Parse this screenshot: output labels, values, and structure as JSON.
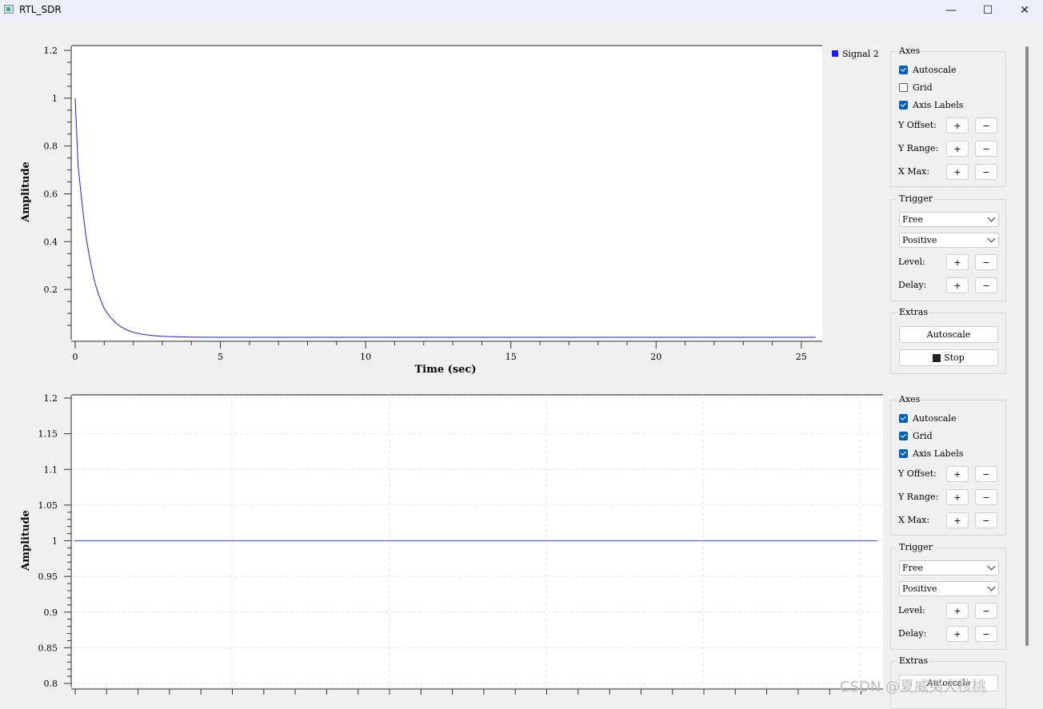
{
  "window": {
    "title": "RTL_SDR",
    "minimize": "—",
    "maximize": "☐",
    "close": "✕"
  },
  "plot1": {
    "ylabel": "Amplitude",
    "xlabel": "Time (sec)",
    "legend": "Signal 2",
    "grid": false,
    "series_color": "#1a1aff",
    "y_ticks": [
      "0.2",
      "0.4",
      "0.6",
      "0.8",
      "1",
      "1.2"
    ],
    "x_ticks": [
      "0",
      "5",
      "10",
      "15",
      "20",
      "25"
    ]
  },
  "plot2": {
    "ylabel": "Amplitude",
    "grid": true,
    "series_color": "#5566ee",
    "y_ticks": [
      "0.8",
      "0.85",
      "0.9",
      "0.95",
      "1",
      "1.05",
      "1.1",
      "1.15",
      "1.2"
    ]
  },
  "chart_data": [
    {
      "type": "line",
      "title": "",
      "xlabel": "Time (sec)",
      "ylabel": "Amplitude",
      "xlim": [
        -0.2,
        25.8
      ],
      "ylim": [
        0,
        1.22
      ],
      "grid": false,
      "legend": "top-right",
      "series": [
        {
          "name": "Signal 2",
          "x": [
            0,
            0.1,
            0.2,
            0.3,
            0.4,
            0.5,
            0.6,
            0.7,
            0.8,
            0.9,
            1,
            1.2,
            1.4,
            1.6,
            1.8,
            2,
            2.3,
            2.6,
            3,
            3.5,
            4,
            5,
            7,
            10,
            15,
            20,
            25.5
          ],
          "y": [
            1,
            0.72,
            0.6,
            0.49,
            0.4,
            0.33,
            0.27,
            0.22,
            0.18,
            0.15,
            0.12,
            0.085,
            0.06,
            0.042,
            0.03,
            0.021,
            0.013,
            0.008,
            0.004,
            0.002,
            0.001,
            0,
            0,
            0,
            0,
            0,
            0
          ]
        }
      ]
    },
    {
      "type": "line",
      "title": "",
      "xlabel": "",
      "ylabel": "Amplitude",
      "ylim": [
        0.8,
        1.2
      ],
      "grid": true,
      "series": [
        {
          "x": [
            0,
            1
          ],
          "y": [
            1,
            1
          ]
        }
      ]
    }
  ],
  "panel1": {
    "axes": {
      "title": "Axes",
      "autoscale": "Autoscale",
      "grid": "Grid",
      "axis_labels": "Axis Labels",
      "autoscale_checked": true,
      "grid_checked": false,
      "axis_labels_checked": true
    },
    "y_offset": "Y Offset:",
    "y_range": "Y Range:",
    "x_max": "X Max:",
    "plus": "+",
    "minus": "−",
    "trigger": {
      "title": "Trigger",
      "mode": "Free",
      "slope": "Positive",
      "level": "Level:",
      "delay": "Delay:"
    },
    "extras": {
      "title": "Extras",
      "autoscale": "Autoscale",
      "stop": "Stop"
    }
  },
  "panel2": {
    "axes": {
      "title": "Axes",
      "autoscale": "Autoscale",
      "grid": "Grid",
      "axis_labels": "Axis Labels",
      "autoscale_checked": true,
      "grid_checked": true,
      "axis_labels_checked": true
    },
    "y_offset": "Y Offset:",
    "y_range": "Y Range:",
    "x_max": "X Max:",
    "plus": "+",
    "minus": "−",
    "trigger": {
      "title": "Trigger",
      "mode": "Free",
      "slope": "Positive",
      "level": "Level:",
      "delay": "Delay:"
    },
    "extras": {
      "title": "Extras",
      "autoscale": "Autoscale"
    }
  },
  "watermark": "CSDN @夏威夷大核桃"
}
